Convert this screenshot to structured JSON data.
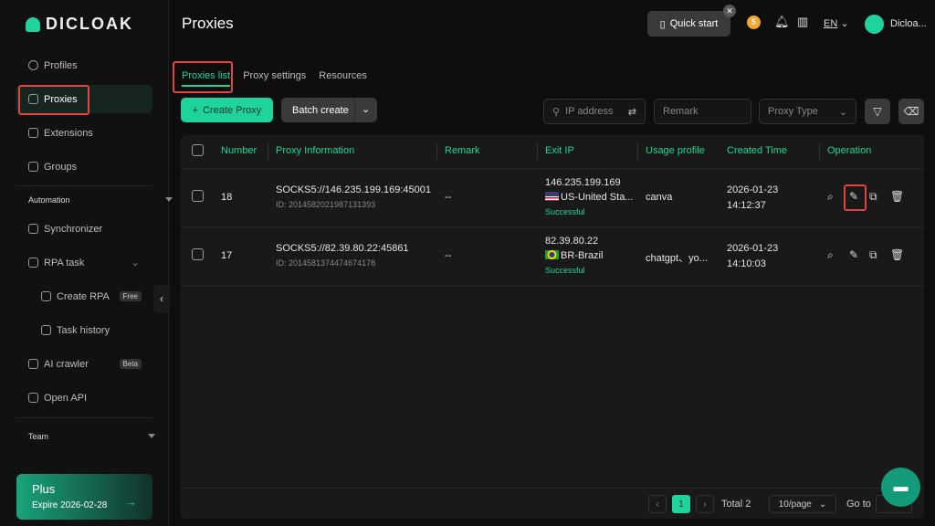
{
  "brand": "DICLOAK",
  "sidebar": {
    "items": [
      {
        "label": "Profiles",
        "icon": "chrome-icon"
      },
      {
        "label": "Proxies",
        "icon": "proxy-icon"
      },
      {
        "label": "Extensions",
        "icon": "command-icon"
      },
      {
        "label": "Groups",
        "icon": "groups-icon"
      }
    ],
    "automation": {
      "label": "Automation",
      "items": [
        {
          "label": "Synchronizer"
        },
        {
          "label": "RPA task"
        },
        {
          "label": "Create RPA",
          "badge": "Free"
        },
        {
          "label": "Task history"
        },
        {
          "label": "AI crawler",
          "badge": "Beta"
        },
        {
          "label": "Open API"
        }
      ]
    },
    "team": "Team",
    "plan": {
      "name": "Plus",
      "expire": "Expire 2026-02-28"
    }
  },
  "header": {
    "title": "Proxies",
    "quick_start": "Quick start",
    "lang": "EN",
    "user": "Dicloa..."
  },
  "tabs": [
    "Proxies list",
    "Proxy settings",
    "Resources"
  ],
  "toolbar": {
    "create": "Create Proxy",
    "batch": "Batch create",
    "ip_placeholder": "IP address",
    "remark_placeholder": "Remark",
    "proxy_type": "Proxy Type"
  },
  "table": {
    "columns": [
      "Number",
      "Proxy Information",
      "Remark",
      "Exit IP",
      "Usage profile",
      "Created Time",
      "Operation"
    ],
    "rows": [
      {
        "number": "18",
        "proxy": "SOCKS5://146.235.199.169:45001",
        "id": "ID: 2014582021987131393",
        "remark": "--",
        "ip": "146.235.199.169",
        "country": "US-United Sta...",
        "status": "Successful",
        "usage": "canva",
        "date": "2026-01-23",
        "time": "14:12:37"
      },
      {
        "number": "17",
        "proxy": "SOCKS5://82.39.80.22:45861",
        "id": "ID: 2014581374474674178",
        "remark": "--",
        "ip": "82.39.80.22",
        "country": "BR-Brazil",
        "status": "Successful",
        "usage": "chatgpt、yo...",
        "date": "2026-01-23",
        "time": "14:10:03"
      }
    ]
  },
  "pagination": {
    "page": "1",
    "total": "Total 2",
    "per_page": "10/page",
    "goto": "Go to"
  },
  "colors": {
    "accent": "#1ed49c",
    "highlight": "#e2453f"
  }
}
